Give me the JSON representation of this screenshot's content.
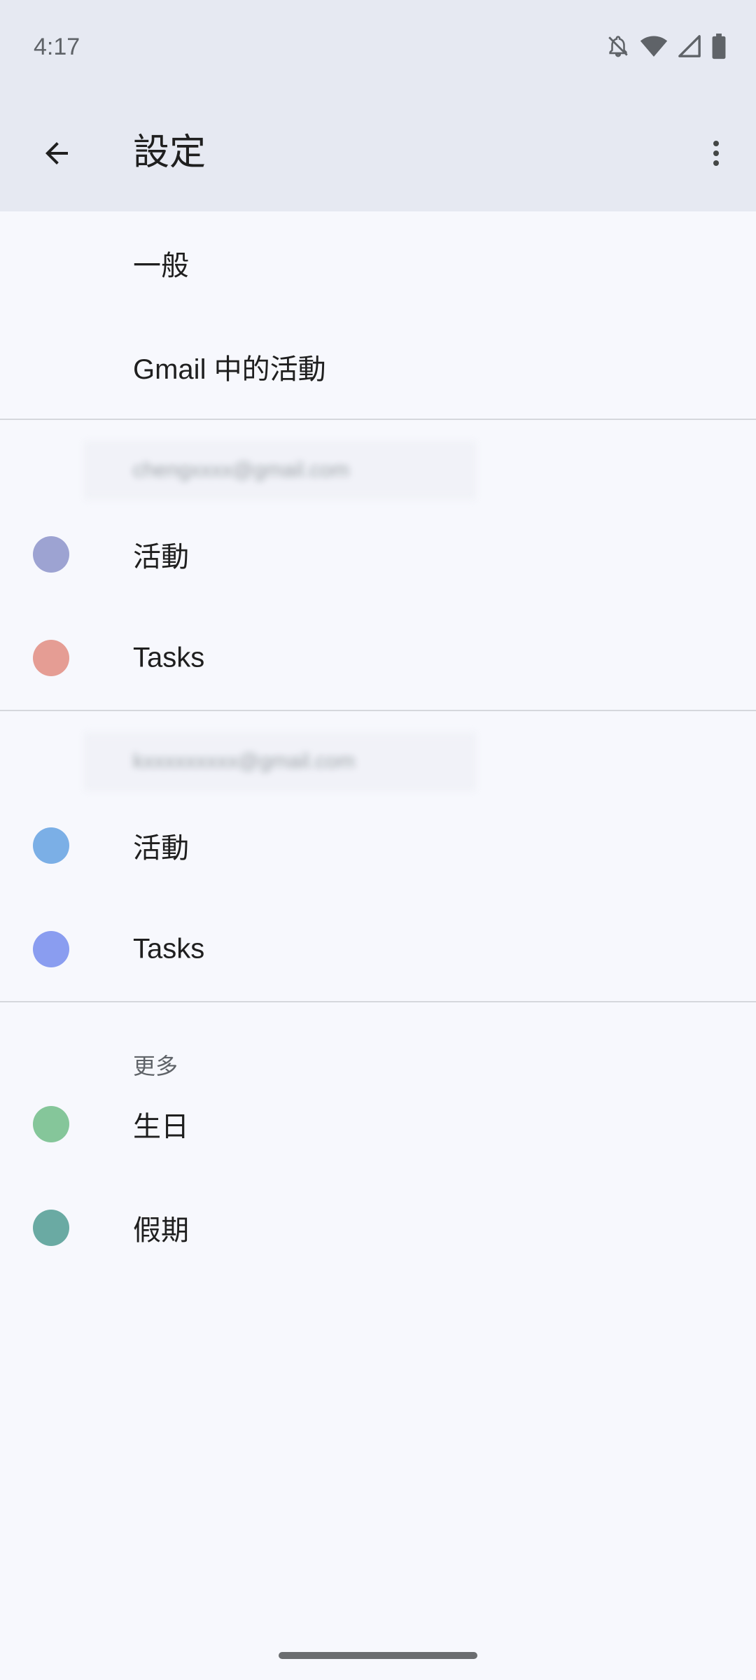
{
  "status_bar": {
    "time": "4:17",
    "icons": [
      "bell-off-icon",
      "wifi-icon",
      "signal-icon",
      "battery-icon"
    ]
  },
  "app_bar": {
    "back_icon": "arrow-back-icon",
    "title": "設定",
    "more_icon": "more-vert-icon"
  },
  "sections": {
    "general": {
      "items": [
        {
          "label": "一般"
        },
        {
          "label": "Gmail 中的活動"
        }
      ]
    },
    "account1": {
      "email": "chengxxxx@gmail.com",
      "items": [
        {
          "label": "活動",
          "color": "#9da3d2"
        },
        {
          "label": "Tasks",
          "color": "#e59d94"
        }
      ]
    },
    "account2": {
      "email": "kxxxxxxxxx@gmail.com",
      "items": [
        {
          "label": "活動",
          "color": "#7bafe6"
        },
        {
          "label": "Tasks",
          "color": "#8a9df0"
        }
      ]
    },
    "more": {
      "heading": "更多",
      "items": [
        {
          "label": "生日",
          "color": "#85c69a"
        },
        {
          "label": "假期",
          "color": "#6aaaa3"
        }
      ]
    }
  }
}
